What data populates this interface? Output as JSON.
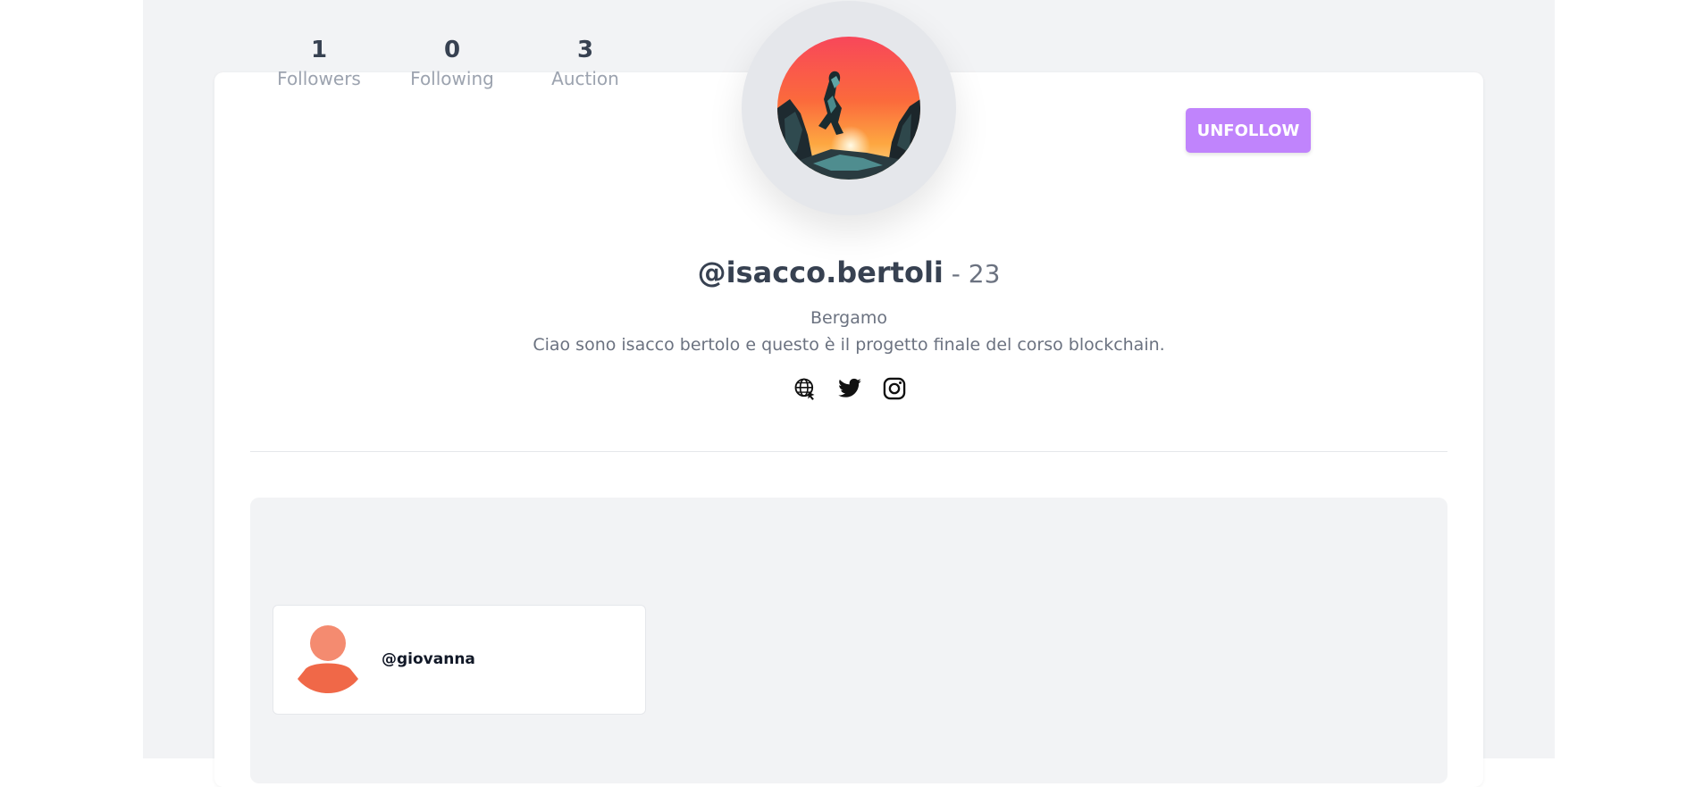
{
  "profile": {
    "stats": [
      {
        "value": "1",
        "label": "Followers"
      },
      {
        "value": "0",
        "label": "Following"
      },
      {
        "value": "3",
        "label": "Auction"
      }
    ],
    "unfollow_label": "UNFOLLOW",
    "username": "@isacco.bertoli",
    "age_text": " - 23",
    "location": "Bergamo",
    "bio": "Ciao sono isacco bertolo e questo è il progetto finale del corso blockchain.",
    "social_icons": [
      "globe-icon",
      "twitter-icon",
      "instagram-icon"
    ]
  },
  "followers_list": {
    "items": [
      {
        "username": "@giovanna"
      }
    ]
  },
  "colors": {
    "accent": "#c084fc",
    "page_background": "#f2f3f5",
    "avatar_placeholder": "#f07b5d"
  }
}
